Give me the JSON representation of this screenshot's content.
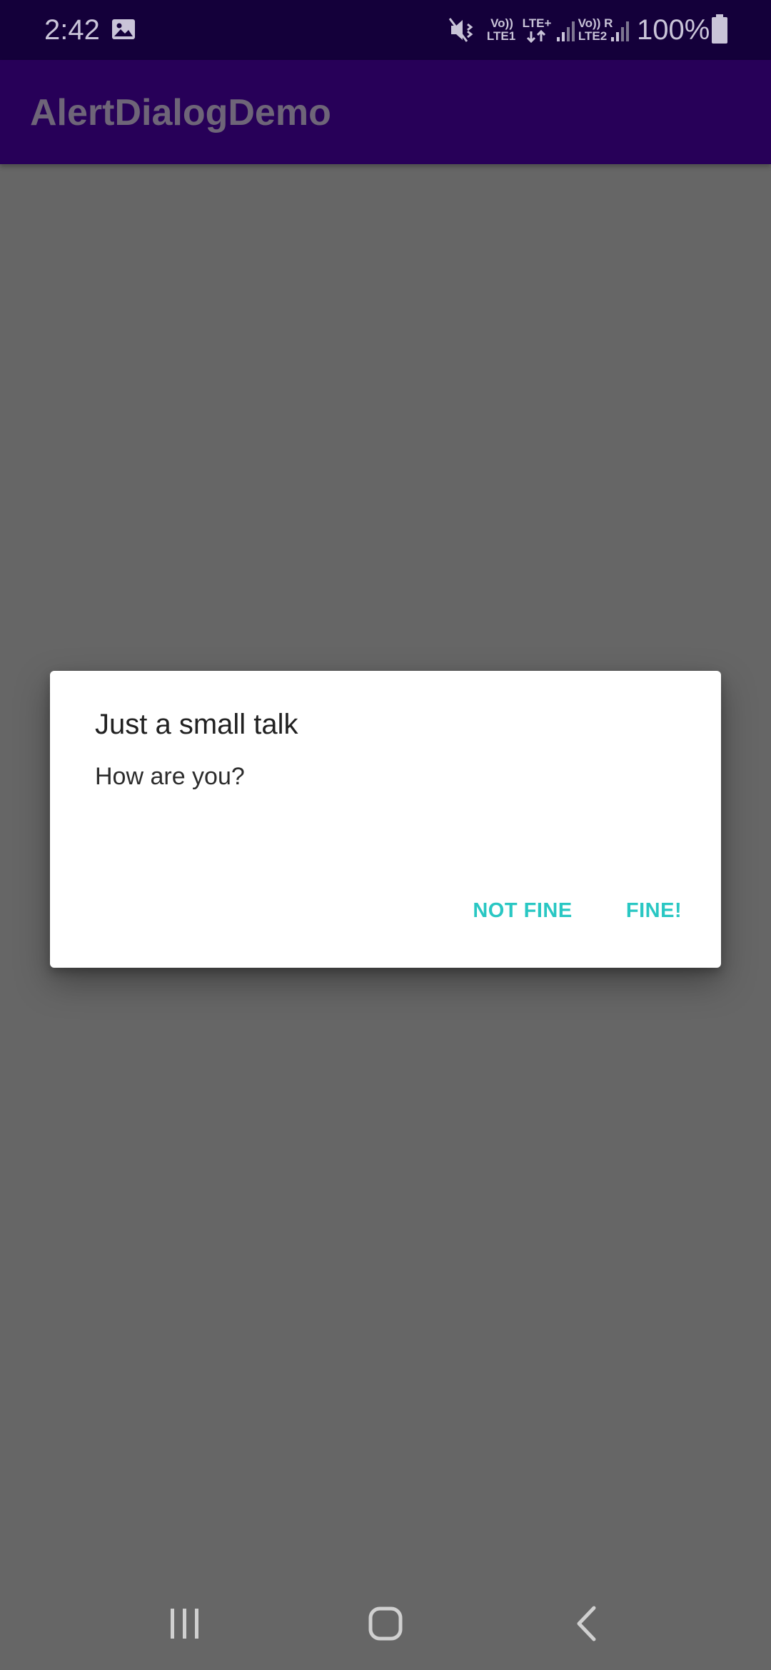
{
  "status_bar": {
    "time": "2:42",
    "sim1_top": "Vo))",
    "sim1_bottom": "LTE1",
    "data_type": "LTE+",
    "sim2_top": "Vo)) R",
    "sim2_bottom": "LTE2",
    "battery_text": "100%",
    "icons": [
      "gallery-icon",
      "mute-icon",
      "data-arrows-icon",
      "signal-icon",
      "battery-icon"
    ]
  },
  "app_bar": {
    "title": "AlertDialogDemo"
  },
  "dialog": {
    "title": "Just a small talk",
    "message": "How are you?",
    "negative_button": "NOT FINE",
    "positive_button": "FINE!"
  },
  "nav_bar": {
    "icons": [
      "recent-apps-icon",
      "home-icon",
      "back-icon"
    ]
  },
  "colors": {
    "status_bar": "#14003a",
    "app_bar": "#270058",
    "scrim_background": "#666666",
    "dialog_background": "#ffffff",
    "dialog_button_text": "#29c7c3"
  }
}
